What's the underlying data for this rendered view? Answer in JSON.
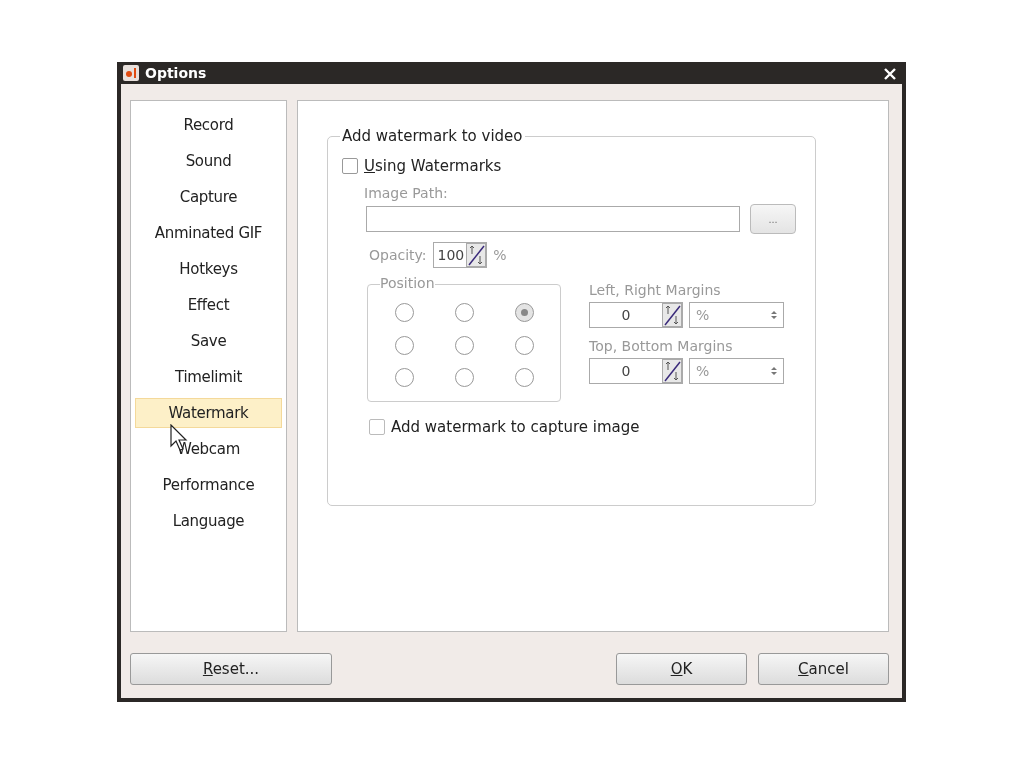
{
  "window": {
    "title": "Options"
  },
  "sidebar": {
    "items": [
      {
        "label": "Record",
        "selected": false
      },
      {
        "label": "Sound",
        "selected": false
      },
      {
        "label": "Capture",
        "selected": false
      },
      {
        "label": "Anminated GIF",
        "selected": false
      },
      {
        "label": "Hotkeys",
        "selected": false
      },
      {
        "label": "Effect",
        "selected": false
      },
      {
        "label": "Save",
        "selected": false
      },
      {
        "label": "Timelimit",
        "selected": false
      },
      {
        "label": "Watermark",
        "selected": true
      },
      {
        "label": "Webcam",
        "selected": false
      },
      {
        "label": "Performance",
        "selected": false
      },
      {
        "label": "Language",
        "selected": false
      }
    ]
  },
  "group": {
    "title": "Add watermark to video",
    "using_watermarks": {
      "label": "Using Watermarks",
      "underline_first": true,
      "checked": false
    },
    "disabled": true,
    "image_path": {
      "label": "Image Path:",
      "browse_button": "..."
    },
    "opacity": {
      "label": "Opacity:",
      "value": "100",
      "unit": "%"
    },
    "position": {
      "title": "Position",
      "options": [
        {
          "selected": false
        },
        {
          "selected": false
        },
        {
          "selected": true
        },
        {
          "selected": false
        },
        {
          "selected": false
        },
        {
          "selected": false
        },
        {
          "selected": false
        },
        {
          "selected": false
        },
        {
          "selected": false
        }
      ]
    },
    "margins": [
      {
        "label": "Left, Right Margins",
        "value": "0",
        "unit": "%"
      },
      {
        "label": "Top, Bottom Margins",
        "value": "0",
        "unit": "%"
      }
    ],
    "capture_image": {
      "label": "Add watermark to capture image",
      "checked": false
    }
  },
  "buttons": {
    "reset": {
      "label": "Reset...",
      "underline_first": true
    },
    "ok": {
      "label": "OK",
      "underline_first": true
    },
    "cancel": {
      "label": "Cancel",
      "underline_first": true
    }
  }
}
